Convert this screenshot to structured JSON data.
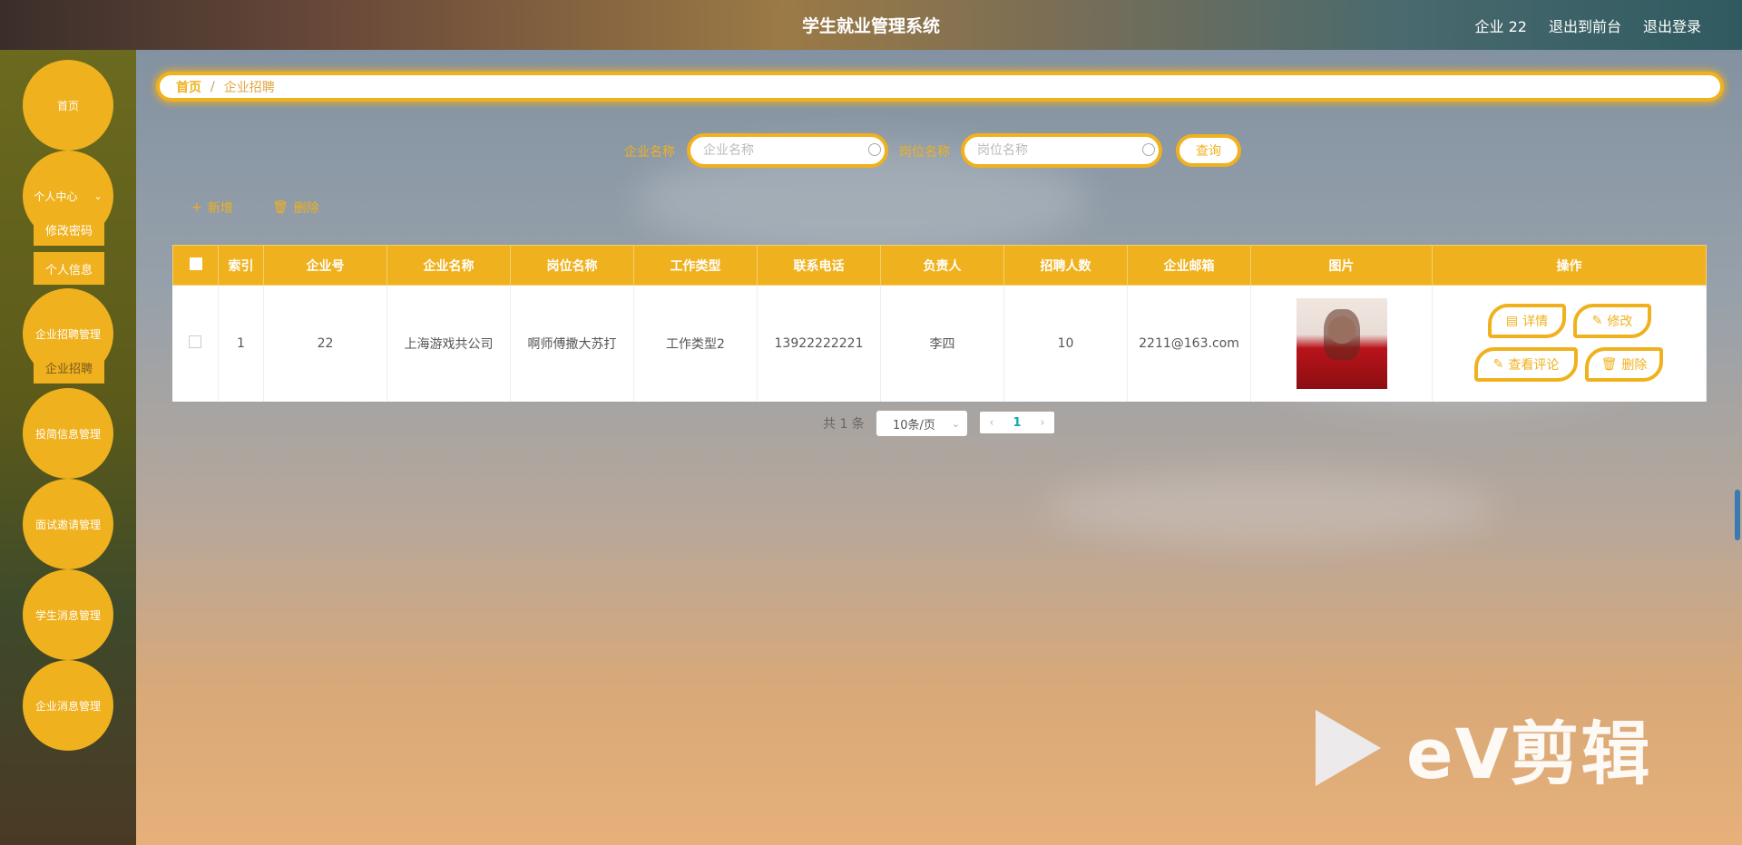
{
  "app": {
    "title": "学生就业管理系统",
    "user": "企业 22",
    "to_front": "退出到前台",
    "logout": "退出登录"
  },
  "sidebar": {
    "items": [
      {
        "label": "首页"
      },
      {
        "label": "个人中心",
        "sub": [
          "修改密码",
          "个人信息"
        ]
      },
      {
        "label": "企业招聘管理",
        "sub": [
          "企业招聘"
        ]
      },
      {
        "label": "投简信息管理"
      },
      {
        "label": "面试邀请管理"
      },
      {
        "label": "学生消息管理"
      },
      {
        "label": "企业消息管理"
      }
    ]
  },
  "breadcrumb": {
    "home": "首页",
    "sep": "/",
    "current": "企业招聘"
  },
  "search": {
    "company_label": "企业名称",
    "company_placeholder": "企业名称",
    "job_label": "岗位名称",
    "job_placeholder": "岗位名称",
    "query": "查询"
  },
  "actions": {
    "add": "新增",
    "delete": "删除"
  },
  "table": {
    "headers": [
      "索引",
      "企业号",
      "企业名称",
      "岗位名称",
      "工作类型",
      "联系电话",
      "负责人",
      "招聘人数",
      "企业邮箱",
      "图片",
      "操作"
    ],
    "rows": [
      {
        "index": "1",
        "company_no": "22",
        "company_name": "上海游戏共公司",
        "job_name": "啊师傅撒大苏打",
        "work_type": "工作类型2",
        "phone": "13922222221",
        "manager": "李四",
        "count": "10",
        "email": "2211@163.com",
        "ops": {
          "detail": "详情",
          "edit": "修改",
          "comment": "查看评论",
          "delete": "删除"
        }
      }
    ]
  },
  "pagination": {
    "total": "共 1 条",
    "page_size": "10条/页",
    "current": "1"
  },
  "watermark": {
    "text": "eV剪辑"
  },
  "colors": {
    "accent": "#f0b11e"
  }
}
